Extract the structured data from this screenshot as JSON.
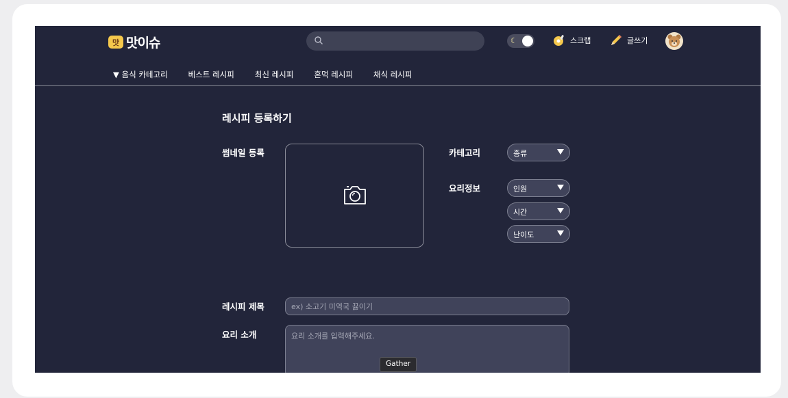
{
  "header": {
    "logo_text": "맛이슈",
    "logo_badge": "맛",
    "search_placeholder": "",
    "scrap_label": "스크랩",
    "write_label": "글쓰기"
  },
  "nav": {
    "items": [
      "▼ 음식 카테고리",
      "베스트 레시피",
      "최신 레시피",
      "혼먹 레시피",
      "채식 레시피"
    ]
  },
  "form": {
    "title": "레시피 등록하기",
    "thumbnail_label": "썸네일 등록",
    "category_label": "카테고리",
    "info_label": "요리정보",
    "category_select": "종류",
    "servings_select": "인원",
    "time_select": "시간",
    "difficulty_select": "난이도",
    "recipe_title_label": "레시피 제목",
    "recipe_title_placeholder": "ex) 소고기 미역국 끓이기",
    "intro_label": "요리 소개",
    "intro_placeholder": "요리 소개를 입력해주세요."
  },
  "tooltip": "Gather",
  "colors": {
    "background": "#22253a",
    "input": "#40435a",
    "logo": "#f5c84c"
  },
  "icons": [
    "search-icon",
    "moon-icon",
    "scrap-icon",
    "pencil-icon",
    "avatar",
    "camera-icon",
    "caret-down-icon"
  ]
}
